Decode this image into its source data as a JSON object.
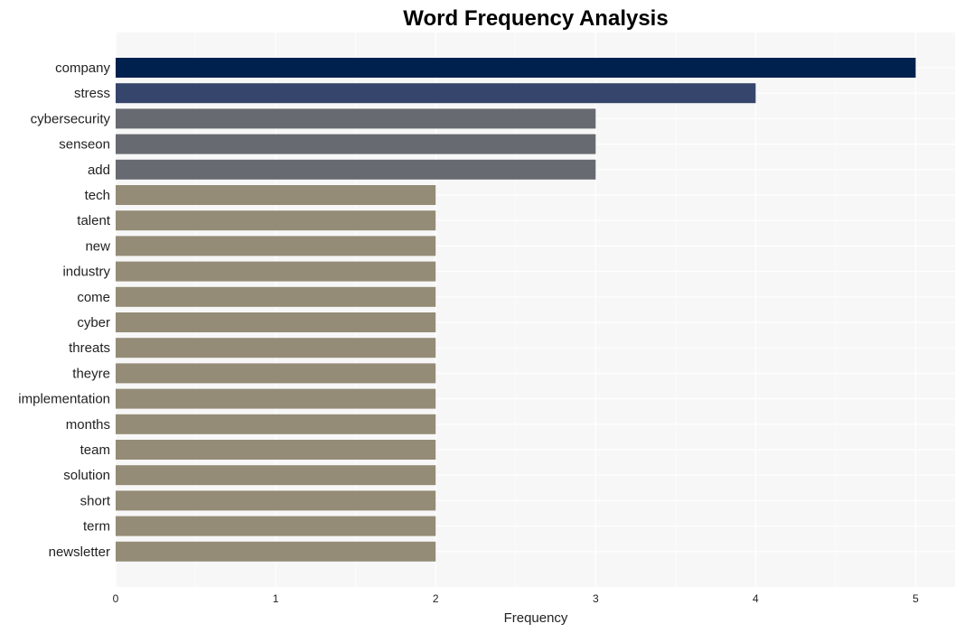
{
  "chart_data": {
    "type": "bar",
    "orientation": "horizontal",
    "title": "Word Frequency Analysis",
    "xlabel": "Frequency",
    "ylabel": "",
    "xlim": [
      0,
      5.25
    ],
    "xticks": [
      0,
      1,
      2,
      3,
      4,
      5
    ],
    "grid": true,
    "legend": "none",
    "categories": [
      "company",
      "stress",
      "cybersecurity",
      "senseon",
      "add",
      "tech",
      "talent",
      "new",
      "industry",
      "come",
      "cyber",
      "threats",
      "theyre",
      "implementation",
      "months",
      "team",
      "solution",
      "short",
      "term",
      "newsletter"
    ],
    "values": [
      5,
      4,
      3,
      3,
      3,
      2,
      2,
      2,
      2,
      2,
      2,
      2,
      2,
      2,
      2,
      2,
      2,
      2,
      2,
      2
    ],
    "colors": {
      "5": "#00214d",
      "4": "#36456b",
      "3": "#676a70",
      "2": "#948c77"
    },
    "panel_background": "#f7f7f7",
    "gridline_color": "#ffffff"
  }
}
